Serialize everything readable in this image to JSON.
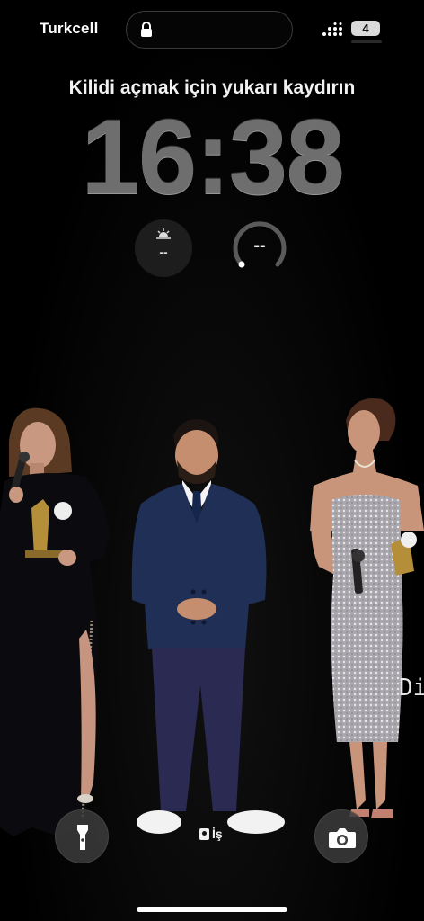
{
  "status_bar": {
    "carrier": "Turkcell",
    "battery_level": "4"
  },
  "lock_screen": {
    "hint": "Kilidi açmak için yukarı kaydırın",
    "time": "16:38"
  },
  "widgets": {
    "sunrise": {
      "icon": "sunrise-icon",
      "value": "--"
    },
    "gauge": {
      "icon": "ring-gauge-icon",
      "value": "--"
    }
  },
  "wallpaper": {
    "side_text": "Di"
  },
  "bottom_bar": {
    "flashlight_icon": "flashlight-icon",
    "camera_icon": "camera-icon",
    "focus_label": "İş"
  },
  "colors": {
    "background": "#000000",
    "clock": "#6e6e6e",
    "widget_bg": "#1d1d1d"
  }
}
